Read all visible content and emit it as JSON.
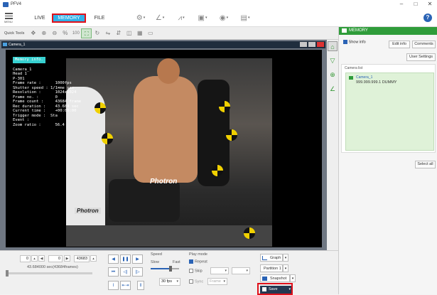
{
  "window": {
    "title": "PFV4"
  },
  "menu": {
    "hamburger_label": "MENU",
    "tabs": [
      {
        "label": "LIVE"
      },
      {
        "label": "MEMORY",
        "active": true
      },
      {
        "label": "FILE"
      }
    ],
    "help_label": "?"
  },
  "quicktools": {
    "label": "Quick Tools",
    "zoom_label": "100"
  },
  "camera_window": {
    "title": "Camera_1"
  },
  "memory_info": {
    "heading": "Memory info.",
    "lines": [
      "Camera_1",
      "",
      "Head 1",
      "P-301",
      "",
      "Frame rate :      1000fps",
      "Shutter speed : 1/1∞me sec",
      "Resolution :      1024x1024",
      "",
      "Frame no. :       0",
      "Frame count :     43684 frame",
      "Rec duration :    43.684 sec",
      "Current time :    +00:00:00",
      "",
      "Trigger mode :  Sta",
      "Event :",
      "",
      "Zoom ratio :      56.4"
    ]
  },
  "video": {
    "brand_center": "Photron",
    "brand_left": "Photron"
  },
  "right_panel": {
    "title": "MEMORY",
    "show_info_label": "Show info",
    "edit_info_label": "Edit info",
    "comments_label": "Comments",
    "user_settings_label": "User Settings",
    "camera_list_title": "Camera list",
    "camera_name": "Camera_1",
    "camera_info": "999.999.999.1  DUMMY",
    "select_all_label": "Select all"
  },
  "playback": {
    "start_frame": "0",
    "current_frame": "0",
    "end_frame": "43683",
    "duration_text": "43.684000 sec(43684frames)",
    "timeline_position": 0.0
  },
  "speed": {
    "label": "Speed",
    "slow_label": "Slow",
    "fast_label": "Fast",
    "level": 0.7,
    "fps_value": "30 fps"
  },
  "play_mode": {
    "label": "Play mode",
    "repeat_label": "Repeat",
    "skip_label": "Skip",
    "sync_label": "Sync",
    "sync_value": "Frame"
  },
  "actions": {
    "graph_label": "Graph",
    "partition_label": "Partition 1",
    "snapshot_label": "Snapshot",
    "save_label": "Save"
  }
}
